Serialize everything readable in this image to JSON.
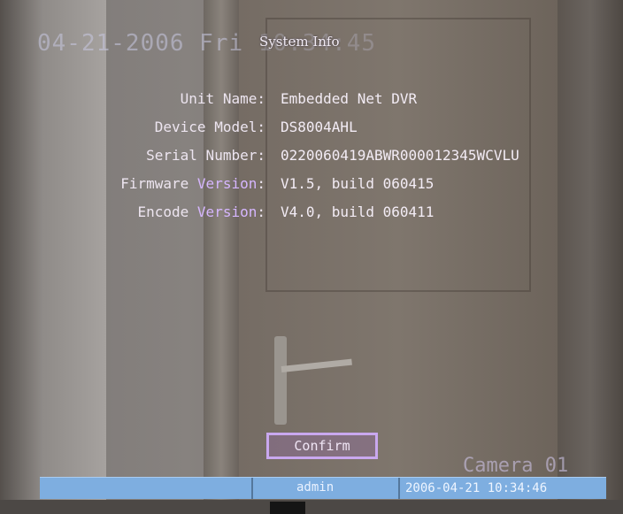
{
  "osd": {
    "date_text": "04-21-2006 Fri",
    "time_ghost": "10:34:45",
    "camera_label": "Camera 01"
  },
  "dialog": {
    "title": "System Info",
    "fields": [
      {
        "label_a": "Unit Name",
        "label_b": "",
        "value": "Embedded Net DVR"
      },
      {
        "label_a": "Device Model",
        "label_b": "",
        "value": "DS8004AHL"
      },
      {
        "label_a": "Serial Number",
        "label_b": "",
        "value": "0220060419ABWR000012345WCVLU"
      },
      {
        "label_a": "Firmware ",
        "label_b": "Version",
        "value": "V1.5, build 060415"
      },
      {
        "label_a": "Encode ",
        "label_b": "Version",
        "value": "V4.0, build 060411"
      }
    ],
    "label_suffix": ":",
    "confirm_label": "Confirm"
  },
  "status_bar": {
    "user": "admin",
    "datetime": "2006-04-21 10:34:46"
  },
  "colors": {
    "label_text": "#ede5f0",
    "label_highlight": "#d6b6ff",
    "button_border": "#c9a8ef",
    "status_bar": "#7eaee0"
  }
}
